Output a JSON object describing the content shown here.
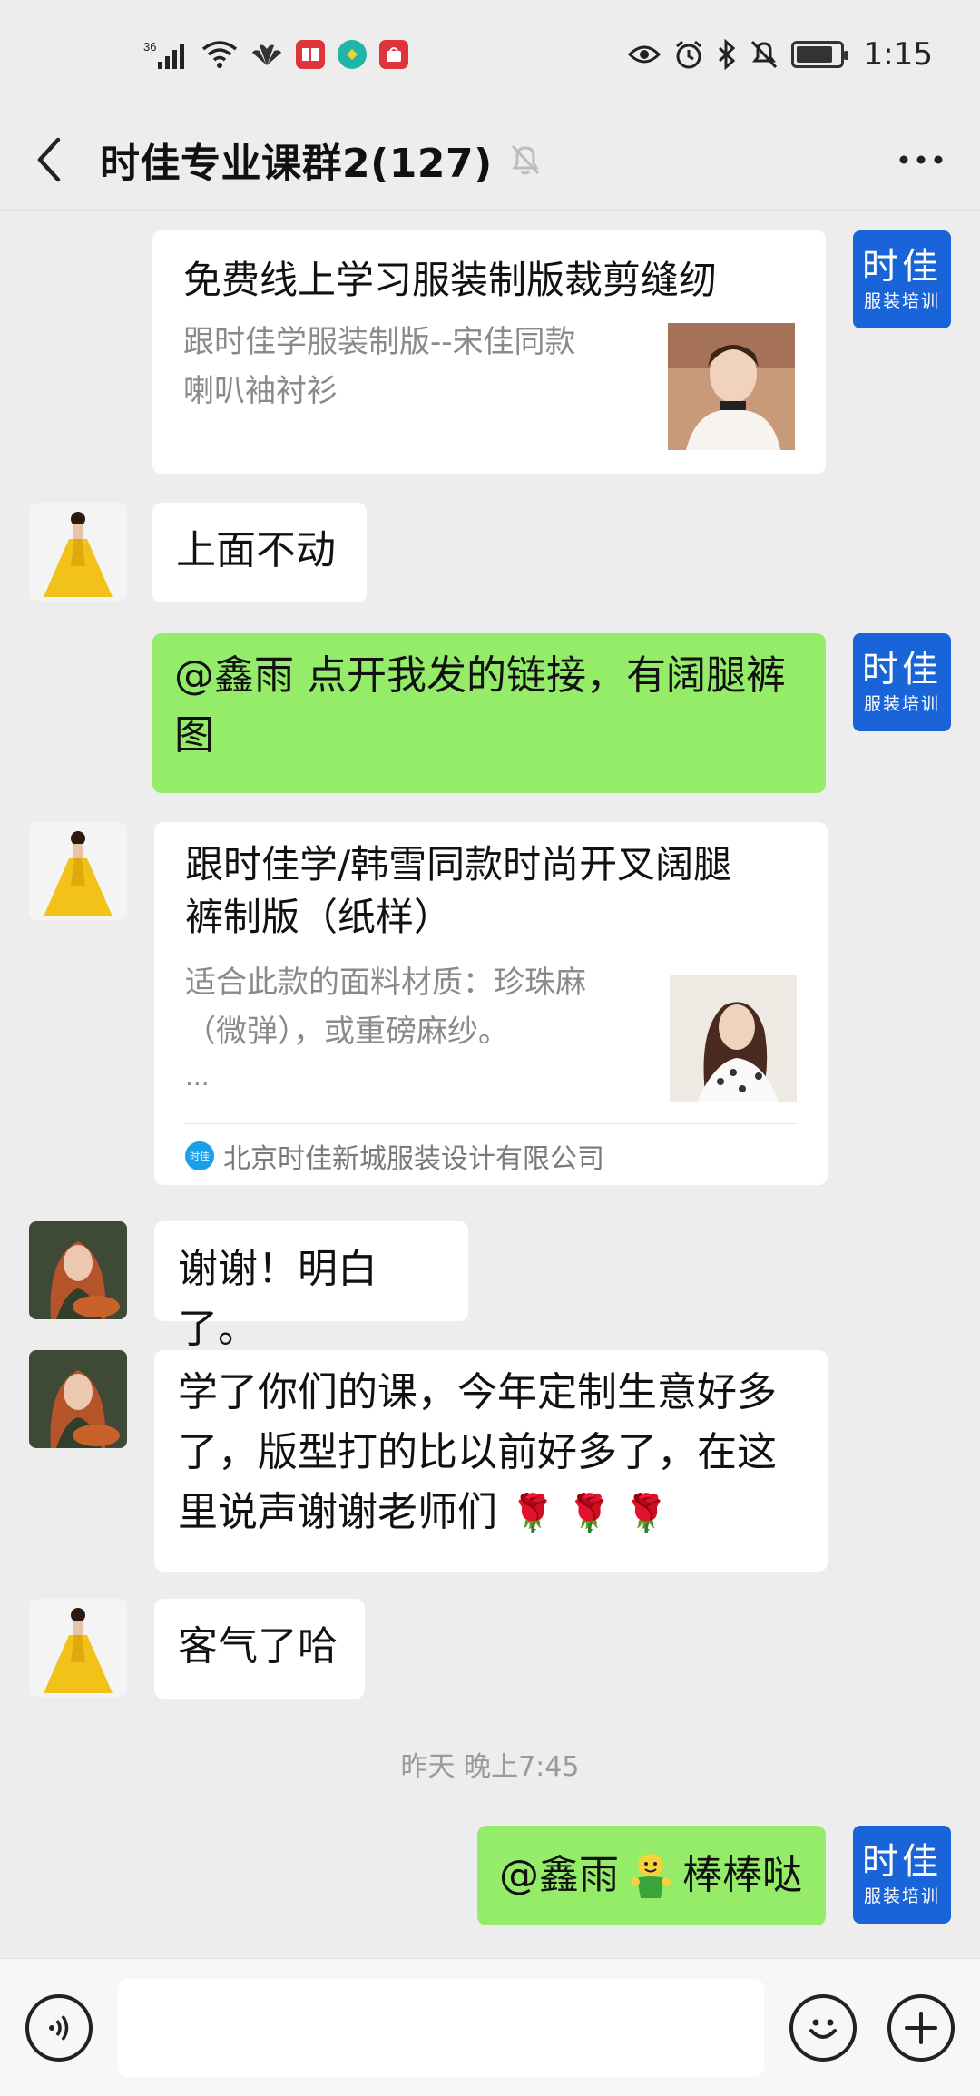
{
  "status_bar": {
    "network": "36",
    "time": "1:15",
    "battery_level": 0.85,
    "app_icons": [
      "reader-app-icon",
      "browser-app-icon",
      "shopping-app-icon"
    ]
  },
  "header": {
    "title": "时佳专业课群2(127)",
    "muted": true
  },
  "brand_avatar": {
    "line1": "时佳",
    "line2": "服装培训"
  },
  "messages": {
    "m1": {
      "type": "link-card",
      "sender": "self",
      "title": "免费线上学习服装制版裁剪缝纫",
      "desc_line1": "跟时佳学服装制版--宋佳同款",
      "desc_line2": "喇叭袖衬衫"
    },
    "m2": {
      "sender": "yellow-dress-avatar",
      "text": "上面不动"
    },
    "m3": {
      "sender": "self",
      "line1": "@鑫雨 点开我发的链接，有阔腿裤",
      "line2": "图"
    },
    "m4": {
      "type": "article-card",
      "sender": "yellow-dress-avatar",
      "title_line1": "跟时佳学/韩雪同款时尚开叉阔腿",
      "title_line2": "裤制版（纸样）",
      "desc_line1": "适合此款的面料材质：珍珠麻",
      "desc_line2": "（微弹），或重磅麻纱。",
      "desc_line3": "...",
      "source": "北京时佳新城服装设计有限公司",
      "source_icon_text": "时佳"
    },
    "m5": {
      "sender": "red-hair-avatar",
      "text": "谢谢！明白了。"
    },
    "m6": {
      "sender": "red-hair-avatar",
      "line1": "学了你们的课，今年定制生意好多",
      "line2": "了，版型打的比以前好多了，在这",
      "line3": "里说声谢谢老师们",
      "emoji": "🌹 🌹 🌹"
    },
    "m7": {
      "sender": "yellow-dress-avatar",
      "text": "客气了哈"
    },
    "timestamp": "昨天 晚上7:45",
    "m8": {
      "sender": "self",
      "mention": "@鑫雨",
      "text": "棒棒哒"
    }
  },
  "colors": {
    "chat_bg": "#ededed",
    "self_bubble": "#95ec69",
    "other_bubble": "#ffffff",
    "brand_blue": "#1964d8"
  }
}
